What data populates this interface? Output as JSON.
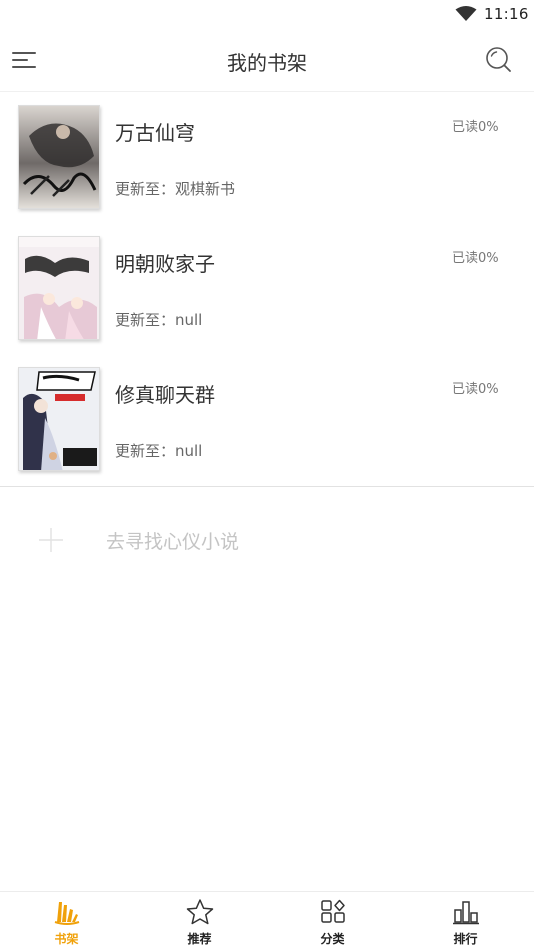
{
  "status_bar": {
    "time": "11:16"
  },
  "header": {
    "title": "我的书架"
  },
  "books": [
    {
      "title": "万古仙穹",
      "progress": "已读0%",
      "update": "更新至：观棋新书"
    },
    {
      "title": "明朝败家子",
      "progress": "已读0%",
      "update": "更新至：null"
    },
    {
      "title": "修真聊天群",
      "progress": "已读0%",
      "update": "更新至：null"
    }
  ],
  "find_more": {
    "label": "去寻找心仪小说"
  },
  "bottom_nav": {
    "items": [
      {
        "label": "书架",
        "icon": "bookshelf-icon",
        "active": true
      },
      {
        "label": "推荐",
        "icon": "star-icon",
        "active": false
      },
      {
        "label": "分类",
        "icon": "category-icon",
        "active": false
      },
      {
        "label": "排行",
        "icon": "ranking-icon",
        "active": false
      }
    ]
  },
  "colors": {
    "accent": "#f0a10a",
    "text": "#333333",
    "muted": "#c4c4c4"
  }
}
